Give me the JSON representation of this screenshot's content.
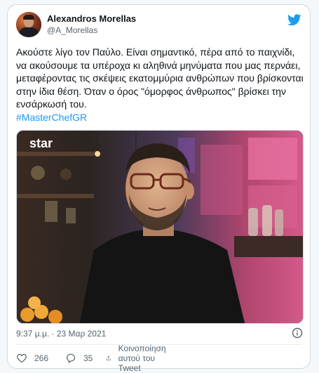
{
  "tweet": {
    "author_name": "Alexandros Morellas",
    "author_handle": "@A_Morellas",
    "text": "Ακούστε λίγο τον Παύλο. Είναι σημαντικό, πέρα από το παιχνίδι, να ακούσουμε τα υπέροχα κι αληθινά μηνύματα που μας περνάει, μεταφέροντας τις σκέψεις εκατομμύρια ανθρώπων που βρίσκονται στην ίδια θέση. Όταν ο όρος \"όμορφος άνθρωπος\" βρίσκει την ενσάρκωσή του.",
    "hashtag": "#MasterChefGR",
    "timestamp": "9:37 μ.μ. · 23 Μαρ 2021",
    "likes": "266",
    "replies": "35",
    "share_label": "Κοινοποίηση αυτού του Tweet"
  },
  "media": {
    "watermark": "star"
  },
  "icons": {
    "brand": "twitter-bird-icon",
    "info": "info-icon",
    "like": "heart-icon",
    "reply": "reply-icon",
    "share": "share-icon"
  },
  "colors": {
    "accent": "#1d9bf0",
    "secondary_text": "#536471",
    "border": "#cfd9de"
  }
}
